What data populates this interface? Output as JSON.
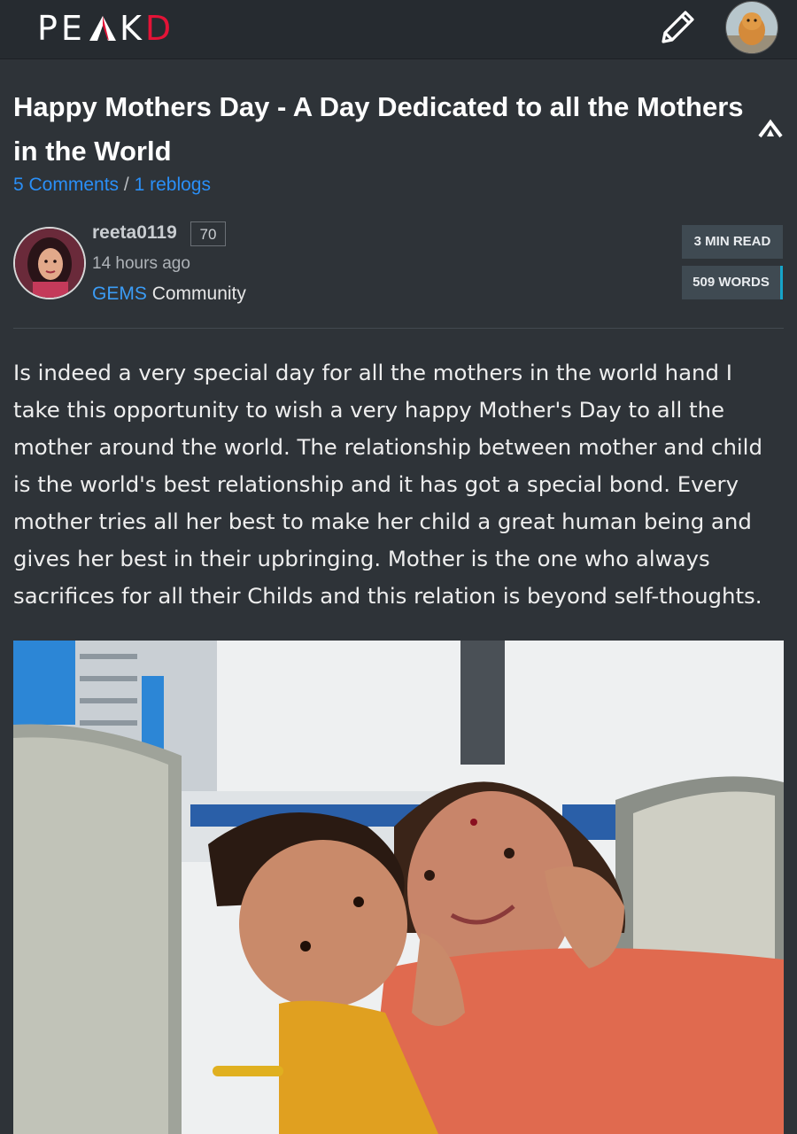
{
  "header": {
    "logo_left": "PE",
    "logo_mid": "K",
    "logo_right": "D",
    "edit_icon": "pencil-icon",
    "profile_icon": "avatar"
  },
  "post": {
    "title": "Happy Mothers Day - A Day Dedicated to all the Mothers in the World",
    "comments": "5 Comments",
    "separator": "/",
    "reblogs": "1 reblogs",
    "author": "reeta0119",
    "reputation": "70",
    "time": "14 hours ago",
    "community_tag": "GEMS",
    "community_word": "Community",
    "read_time": "3 MIN READ",
    "word_count": "509 WORDS",
    "body": "Is indeed a very special day for all the mothers in the world hand I take this opportunity to wish a very happy Mother's Day to all the mother around the world. The relationship between mother and child is the world's best relationship and it has got a special bond. Every mother tries all her best to make her child a great human being and gives her best in their upbringing. Mother is the one who always sacrifices for all their Childs and this relation is beyond self-thoughts."
  },
  "colors": {
    "background": "#2e3338",
    "topbar": "#262b30",
    "link": "#2a8ff7",
    "brand_red": "#e31337",
    "badge_accent": "#16a4c9"
  }
}
